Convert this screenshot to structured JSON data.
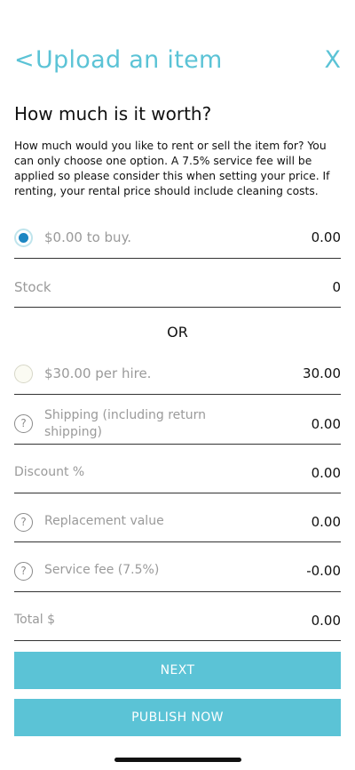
{
  "header": {
    "back": "<",
    "title": "Upload an item",
    "close": "X"
  },
  "question": "How much is it worth?",
  "description": "How much would you like to rent or sell the item for? You can only choose one option. A 7.5% service fee will be applied so please consider this when setting your price. If renting, your rental price should include cleaning costs.",
  "buy": {
    "label": "$0.00 to buy.",
    "value": "0.00",
    "selected": true
  },
  "stock": {
    "label": "Stock",
    "value": "0"
  },
  "or_label": "OR",
  "hire": {
    "label": "$30.00 per hire.",
    "value": "30.00",
    "selected": false
  },
  "shipping": {
    "label_line1": "Shipping (including return",
    "label_line2": "shipping)",
    "value": "0.00",
    "help": "?"
  },
  "discount": {
    "label": "Discount %",
    "value": "0.00"
  },
  "replacement": {
    "label": "Replacement value",
    "value": "0.00",
    "help": "?"
  },
  "service_fee": {
    "label": "Service fee (7.5%)",
    "value": "-0.00",
    "help": "?"
  },
  "total": {
    "label": "Total $",
    "value": "0.00"
  },
  "buttons": {
    "next": "NEXT",
    "publish": "PUBLISH NOW"
  },
  "colors": {
    "accent": "#5bc3d6",
    "radio_selected": "#1d86c2"
  }
}
